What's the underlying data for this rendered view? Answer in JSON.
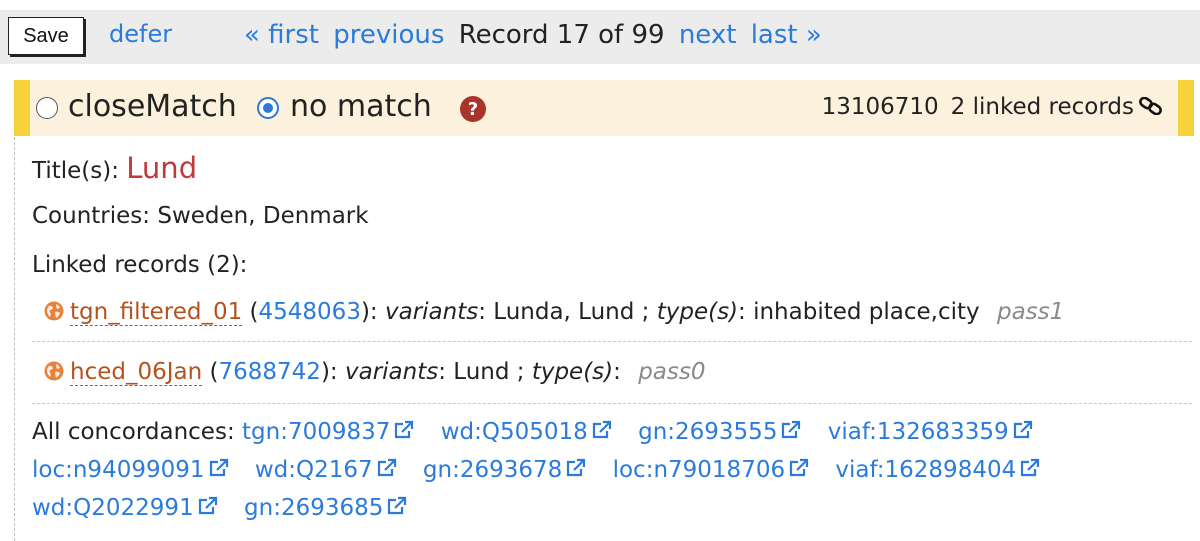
{
  "toolbar": {
    "save_label": "Save",
    "defer_label": "defer",
    "first_label": "« first",
    "previous_label": "previous",
    "status": "Record 17 of 99",
    "next_label": "next",
    "last_label": "last »"
  },
  "match": {
    "option_close": "closeMatch",
    "option_none": "no match",
    "selected": "no match",
    "help_icon": "question-circle-icon",
    "record_id": "13106710",
    "linked_count_label": "2 linked records",
    "link_icon": "chain-link-icon"
  },
  "record": {
    "title_label": "Title(s):",
    "title_value": "Lund",
    "countries_label": "Countries:",
    "countries_value": "Sweden, Denmark",
    "linked_label": "Linked records (2):",
    "linked": [
      {
        "dataset": "tgn_filtered_01",
        "id": "4548063",
        "variants_label": "variants",
        "variants": "Lunda, Lund ;",
        "types_label": "type(s)",
        "types": "inhabited place,city",
        "pass": "pass1"
      },
      {
        "dataset": "hced_06Jan",
        "id": "7688742",
        "variants_label": "variants",
        "variants": "Lund ;",
        "types_label": "type(s)",
        "types": "",
        "pass": "pass0"
      }
    ],
    "concordances_label": "All concordances:",
    "concordances": [
      "tgn:7009837",
      "wd:Q505018",
      "gn:2693555",
      "viaf:132683359",
      "loc:n94099091",
      "wd:Q2167",
      "gn:2693678",
      "loc:n79018706",
      "viaf:162898404",
      "wd:Q2022991",
      "gn:2693685"
    ]
  },
  "colors": {
    "link": "#2b7bdb",
    "highlight_bg": "#fbf1dd",
    "highlight_border": "#f6d23b",
    "title": "#c0393b",
    "dataset": "#b5531f",
    "globe": "#e8823a"
  }
}
